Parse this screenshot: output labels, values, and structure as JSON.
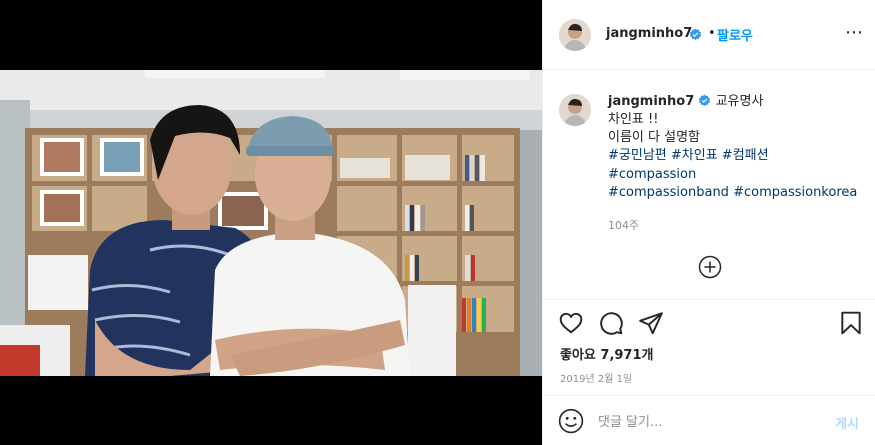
{
  "post_header": {
    "username": "jangminho7",
    "separator": "•",
    "follow_label": "팔로우",
    "more_icon": "⋯"
  },
  "caption": {
    "username": "jangminho7",
    "rest_of_first_line": "교유명사",
    "lines": [
      "차인표 !!",
      "이름이 다 설명함"
    ],
    "hashtags_line1": [
      "#궁민남편",
      "#차인표",
      "#컴패션"
    ],
    "hashtags_line2": [
      "#compassion"
    ],
    "hashtags_line3": [
      "#compassionband",
      "#compassionkorea"
    ],
    "age": "104주"
  },
  "actions": {
    "likes_text": "좋아요 7,971개",
    "date_text": "2019년 2월 1일"
  },
  "comment_box": {
    "placeholder": "댓글 달기...",
    "post_label": "게시"
  },
  "colors": {
    "link_blue": "#0095f6",
    "hashtag_blue": "#00376b",
    "muted_gray": "#8e8e8e",
    "disabled_post_blue": "#b3dbff"
  }
}
